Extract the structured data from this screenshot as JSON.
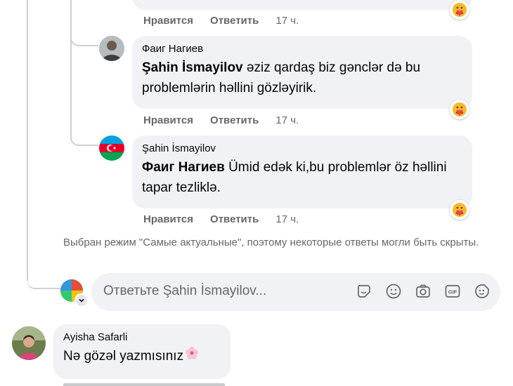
{
  "comments": [
    {
      "author": "",
      "mention": "",
      "text": "",
      "actions": {
        "like": "Нравится",
        "reply": "Ответить",
        "time": "17 ч."
      }
    },
    {
      "author": "Фаиг Нагиев",
      "mention": "Şahin İsmayilov",
      "text": " əziz qardaş biz gənclər də bu problemlərin həllini gözləyirik.",
      "actions": {
        "like": "Нравится",
        "reply": "Ответить",
        "time": "17 ч."
      }
    },
    {
      "author": "Şahin İsmayilov",
      "mention": "Фаиг Нагиев",
      "text": " Ümid edək ki,bu problemlər öz həllini tapar tezliklə.",
      "actions": {
        "like": "Нравится",
        "reply": "Ответить",
        "time": "17 ч."
      }
    }
  ],
  "notice": "Выбран режим \"Самые актуальные\", поэтому некоторые ответы могли быть скрыты.",
  "reply_box": {
    "placeholder": "Ответьте Şahin İsmayilov...",
    "icons": [
      "sticker-icon",
      "emoji-icon",
      "camera-icon",
      "gif-icon",
      "avatar-sticker-icon"
    ]
  },
  "bottom_comment": {
    "author": "Ayisha Safarli",
    "text": "Nə gözəl yazmısınız"
  },
  "colors": {
    "bubble": "#f0f2f5",
    "secondary_text": "#65676b",
    "thread_line": "#ced0d4"
  }
}
